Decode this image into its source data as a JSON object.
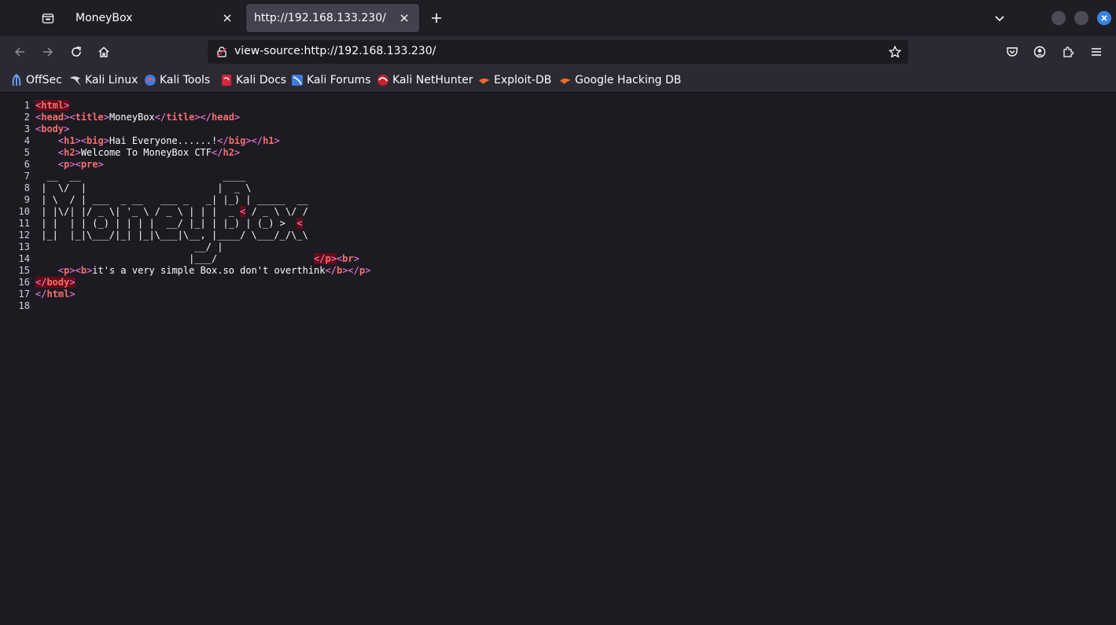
{
  "tabs": [
    {
      "title": "MoneyBox",
      "active": false
    },
    {
      "title": "http://192.168.133.230/",
      "active": true
    }
  ],
  "navbar": {
    "url": "view-source:http://192.168.133.230/"
  },
  "bookmarks": [
    {
      "label": "OffSec",
      "icon": "offsec-icon"
    },
    {
      "label": "Kali Linux",
      "icon": "kali-dragon-icon"
    },
    {
      "label": "Kali Tools",
      "icon": "kali-tools-icon"
    },
    {
      "label": "Kali Docs",
      "icon": "kali-docs-icon"
    },
    {
      "label": "Kali Forums",
      "icon": "kali-forums-icon"
    },
    {
      "label": "Kali NetHunter",
      "icon": "nethunter-icon"
    },
    {
      "label": "Exploit-DB",
      "icon": "exploitdb-icon"
    },
    {
      "label": "Google Hacking DB",
      "icon": "ghdb-icon"
    }
  ],
  "source": {
    "line_numbers": [
      "1",
      "2",
      "3",
      "4",
      "5",
      "6",
      "7",
      "8",
      "9",
      "10",
      "11",
      "12",
      "13",
      "14",
      "15",
      "16",
      "17",
      "18"
    ],
    "title_text": "MoneyBox",
    "h1_text": "Hai Everyone......!",
    "h2_text": "Welcome To MoneyBox CTF",
    "ascii_art": [
      "  __  __                         ____",
      " |  \\/  |                       |  _ \\",
      " | \\  / | ___  _ __   ___ _   _| |_) | _____  __",
      " | |\\/| |/ _ \\| '_ \\ / _ \\ | | |  _ ",
      " | |  | | (_) | | | |  __/ |_| | |_) | (_) >  ",
      " |_|  |_|\\___/|_| |_|\\___|\\__, |____/ \\___/_/\\_\\",
      "                            __/ |",
      "                           |___/                 "
    ],
    "ascii_line10_tail": "/ _ \\ \\/ /",
    "p_text": "it's a very simple Box.so don't overthink"
  },
  "colors": {
    "tag_delim": "#ff7de9",
    "tag_name": "#f76e6e",
    "error_highlight": "#a4000f",
    "background": "#1c1b22",
    "accent_close": "#3584e4"
  }
}
